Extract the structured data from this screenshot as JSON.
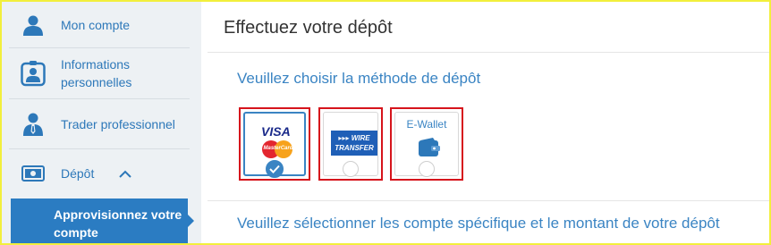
{
  "sidebar": {
    "items": [
      {
        "label": "Mon compte",
        "icon": "user-icon"
      },
      {
        "label": "Informations personnelles",
        "icon": "id-badge-icon"
      },
      {
        "label": "Trader professionnel",
        "icon": "businessman-icon"
      },
      {
        "label": "Dépôt",
        "icon": "banknote-icon",
        "expanded": true
      }
    ],
    "active_subitem": "Approvisionnez votre compte"
  },
  "main": {
    "title": "Effectuez votre dépôt",
    "choose_method": "Veuillez choisir la méthode de dépôt",
    "select_account": "Veuillez sélectionner les compte spécifique et le montant de votre dépôt",
    "methods": [
      {
        "name": "VISA / MasterCard",
        "visa_text": "VISA",
        "mc_text": "MasterCard",
        "selected": true
      },
      {
        "name": "Wire Transfer",
        "line1": "▸▸▸ WIRE",
        "line2": "TRANSFER",
        "selected": false
      },
      {
        "name": "E-Wallet",
        "label": "E-Wallet",
        "selected": false
      }
    ]
  },
  "colors": {
    "accent": "#2b7cc2",
    "link": "#3a84c3",
    "highlight_box": "#d6141c",
    "sidebar_bg": "#edf1f4",
    "frame": "#f2ef3c"
  }
}
